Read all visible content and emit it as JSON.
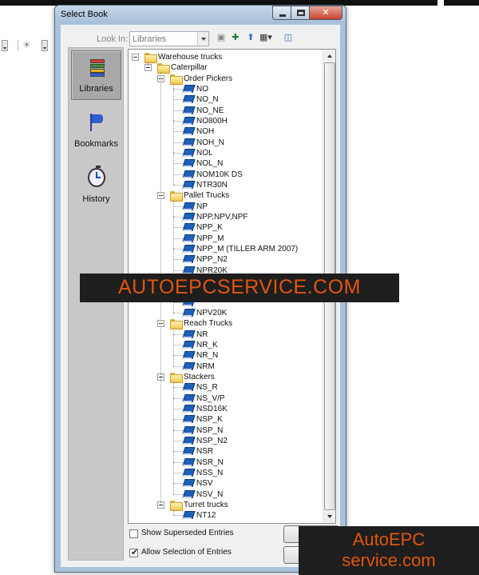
{
  "window": {
    "title": "Select Book"
  },
  "toolbar": {
    "look_in_label": "Look In:",
    "look_in_value": "Libraries",
    "icons": [
      "disk-icon",
      "add-icon",
      "up-folder-icon",
      "view-menu-icon",
      "panel-icon"
    ]
  },
  "nav": [
    {
      "label": "Libraries",
      "icon": "books-icon",
      "active": true
    },
    {
      "label": "Bookmarks",
      "icon": "flag-icon",
      "active": false
    },
    {
      "label": "History",
      "icon": "stopwatch-icon",
      "active": false
    }
  ],
  "tree": [
    {
      "label": "Warehouse trucks",
      "level": 0,
      "kind": "folder",
      "expanded": true
    },
    {
      "label": "Caterpillar",
      "level": 1,
      "kind": "folder",
      "expanded": true
    },
    {
      "label": "Order Pickers",
      "level": 2,
      "kind": "folder",
      "expanded": true
    },
    {
      "label": "NO",
      "level": 3,
      "kind": "book"
    },
    {
      "label": "NO_N",
      "level": 3,
      "kind": "book"
    },
    {
      "label": "NO_NE",
      "level": 3,
      "kind": "book"
    },
    {
      "label": "NO800H",
      "level": 3,
      "kind": "book"
    },
    {
      "label": "NOH",
      "level": 3,
      "kind": "book"
    },
    {
      "label": "NOH_N",
      "level": 3,
      "kind": "book"
    },
    {
      "label": "NOL",
      "level": 3,
      "kind": "book"
    },
    {
      "label": "NOL_N",
      "level": 3,
      "kind": "book"
    },
    {
      "label": "NOM10K DS",
      "level": 3,
      "kind": "book"
    },
    {
      "label": "NTR30N",
      "level": 3,
      "kind": "book"
    },
    {
      "label": "Pallet Trucks",
      "level": 2,
      "kind": "folder",
      "expanded": true
    },
    {
      "label": "NP",
      "level": 3,
      "kind": "book"
    },
    {
      "label": "NPP,NPV,NPF",
      "level": 3,
      "kind": "book"
    },
    {
      "label": "NPP_K",
      "level": 3,
      "kind": "book"
    },
    {
      "label": "NPP_M",
      "level": 3,
      "kind": "book"
    },
    {
      "label": "NPP_M (TILLER ARM 2007)",
      "level": 3,
      "kind": "book"
    },
    {
      "label": "NPP_N2",
      "level": 3,
      "kind": "book"
    },
    {
      "label": "NPR20K",
      "level": 3,
      "kind": "book"
    },
    {
      "label": "NPR20N",
      "level": 3,
      "kind": "book"
    },
    {
      "label": "",
      "level": 3,
      "kind": "book"
    },
    {
      "label": "",
      "level": 3,
      "kind": "book"
    },
    {
      "label": "NPV20K",
      "level": 3,
      "kind": "book"
    },
    {
      "label": "Reach Trucks",
      "level": 2,
      "kind": "folder",
      "expanded": true
    },
    {
      "label": "NR",
      "level": 3,
      "kind": "book"
    },
    {
      "label": "NR_K",
      "level": 3,
      "kind": "book"
    },
    {
      "label": "NR_N",
      "level": 3,
      "kind": "book"
    },
    {
      "label": "NRM",
      "level": 3,
      "kind": "book"
    },
    {
      "label": "Stackers",
      "level": 2,
      "kind": "folder",
      "expanded": true
    },
    {
      "label": "NS_R",
      "level": 3,
      "kind": "book"
    },
    {
      "label": "NS_V/P",
      "level": 3,
      "kind": "book"
    },
    {
      "label": "NSD16K",
      "level": 3,
      "kind": "book"
    },
    {
      "label": "NSP_K",
      "level": 3,
      "kind": "book"
    },
    {
      "label": "NSP_N",
      "level": 3,
      "kind": "book"
    },
    {
      "label": "NSP_N2",
      "level": 3,
      "kind": "book"
    },
    {
      "label": "NSR",
      "level": 3,
      "kind": "book"
    },
    {
      "label": "NSR_N",
      "level": 3,
      "kind": "book"
    },
    {
      "label": "NSS_N",
      "level": 3,
      "kind": "book"
    },
    {
      "label": "NSV",
      "level": 3,
      "kind": "book"
    },
    {
      "label": "NSV_N",
      "level": 3,
      "kind": "book"
    },
    {
      "label": "Turret trucks",
      "level": 2,
      "kind": "folder",
      "expanded": true
    },
    {
      "label": "NT12",
      "level": 3,
      "kind": "book"
    }
  ],
  "options": {
    "show_superseded_label": "Show Superseded Entries",
    "show_superseded_checked": false,
    "allow_selection_label": "Allow Selection of Entries",
    "allow_selection_checked": true
  },
  "watermark": {
    "banner_text": "AUTOEPCSERVICE.COM",
    "corner_line1": "AutoEPC",
    "corner_line2": "service.com"
  },
  "colors": {
    "accent": "#e0560d",
    "book_icon": "#1f5fb8",
    "folder_icon": "#f0c94e",
    "window_frame": "#a9c2db"
  }
}
